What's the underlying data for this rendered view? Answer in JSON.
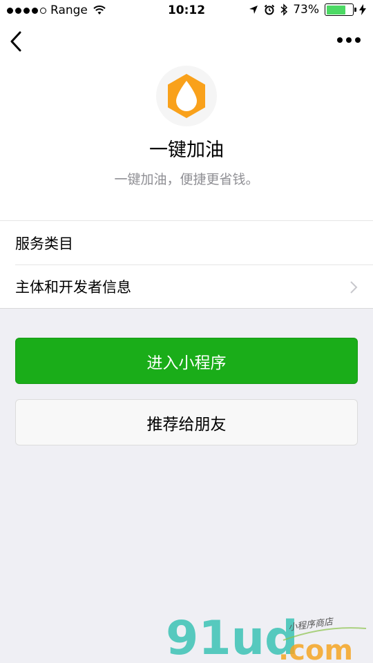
{
  "status_bar": {
    "carrier": "Range",
    "time": "10:12",
    "battery_percent": "73%",
    "battery_level": 0.73,
    "icons": [
      "signal-dots-icon",
      "wifi-icon",
      "location-arrow-icon",
      "alarm-icon",
      "bluetooth-icon",
      "battery-icon",
      "charging-bolt-icon"
    ]
  },
  "nav": {
    "back_icon": "chevron-left-icon",
    "more_icon": "more-dots-icon"
  },
  "app": {
    "name": "一键加油",
    "description": "一键加油，便捷更省钱。",
    "logo_icon": "fuel-drop-hexagon-icon",
    "logo_color": "#f9a11b"
  },
  "list": {
    "items": [
      {
        "label": "服务类目",
        "has_chevron": false
      },
      {
        "label": "主体和开发者信息",
        "has_chevron": true
      }
    ]
  },
  "buttons": {
    "enter_label": "进入小程序",
    "recommend_label": "推荐给朋友",
    "primary_color": "#1aad19"
  },
  "watermark": {
    "brand": "91ud",
    "domain": ".com",
    "tagline": "小程序商店"
  }
}
